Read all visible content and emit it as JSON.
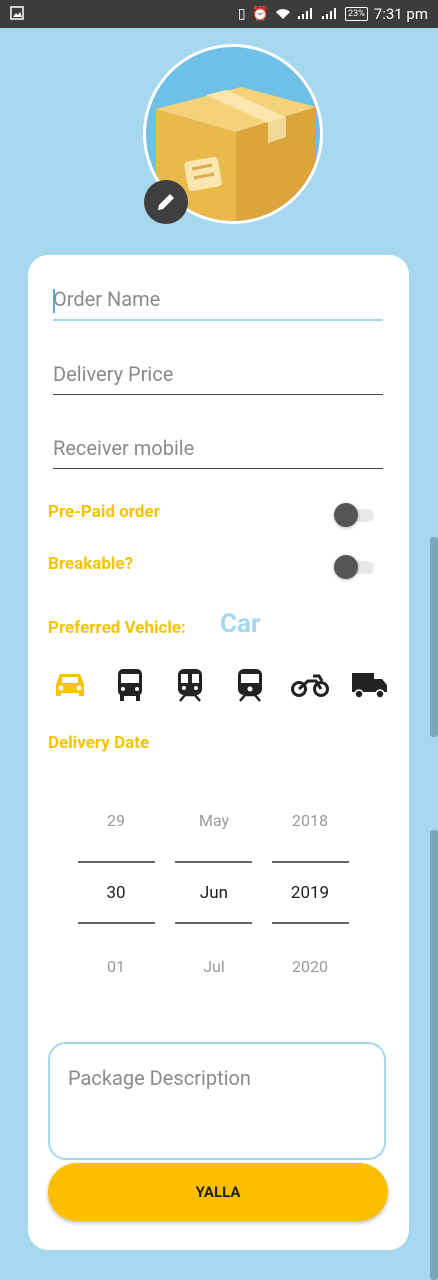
{
  "status_bar": {
    "time": "7:31 pm",
    "battery": "23%"
  },
  "form": {
    "order_name_placeholder": "Order Name",
    "delivery_price_placeholder": "Delivery Price",
    "receiver_mobile_placeholder": "Receiver mobile",
    "prepaid_label": "Pre-Paid order",
    "breakable_label": "Breakable?",
    "preferred_vehicle_label": "Preferred Vehicle:",
    "preferred_vehicle_value": "Car",
    "delivery_date_label": "Delivery Date",
    "package_description_placeholder": "Package Description",
    "submit_label": "YALLA"
  },
  "vehicles": [
    {
      "icon": "car-icon",
      "selected": true
    },
    {
      "icon": "bus-icon",
      "selected": false
    },
    {
      "icon": "train-icon",
      "selected": false
    },
    {
      "icon": "tram-icon",
      "selected": false
    },
    {
      "icon": "motorcycle-icon",
      "selected": false
    },
    {
      "icon": "truck-icon",
      "selected": false
    }
  ],
  "date_picker": {
    "day": {
      "prev": "29",
      "selected": "30",
      "next": "01"
    },
    "month": {
      "prev": "May",
      "selected": "Jun",
      "next": "Jul"
    },
    "year": {
      "prev": "2018",
      "selected": "2019",
      "next": "2020"
    }
  },
  "colors": {
    "accent_yellow": "#f5c400",
    "button_yellow": "#fbbf00",
    "sky_blue": "#a5d7ee"
  }
}
